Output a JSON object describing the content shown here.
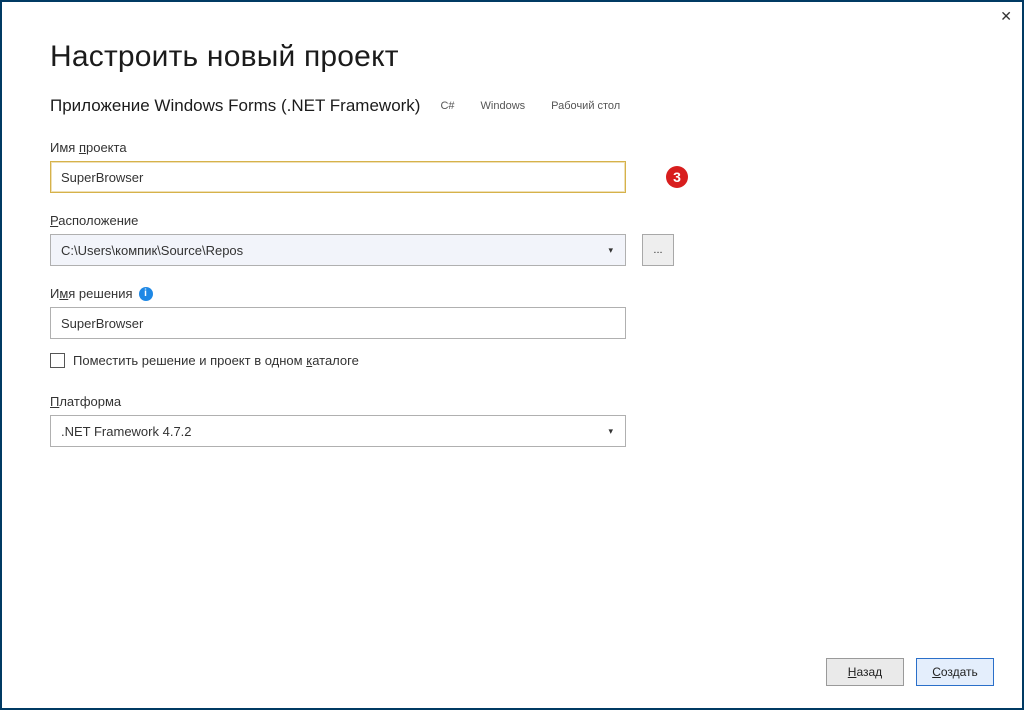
{
  "title": "Настроить новый проект",
  "template": {
    "name": "Приложение Windows Forms (.NET Framework)",
    "tags": [
      "C#",
      "Windows",
      "Рабочий стол"
    ]
  },
  "fields": {
    "projectName": {
      "label_pre": "Имя ",
      "label_key": "п",
      "label_post": "роекта",
      "value": "SuperBrowser"
    },
    "location": {
      "label_key": "Р",
      "label_post": "асположение",
      "value": "C:\\Users\\компик\\Source\\Repos",
      "browse": "..."
    },
    "solutionName": {
      "label_pre": "И",
      "label_key": "м",
      "label_post": "я решения",
      "value": "SuperBrowser"
    },
    "sameDir": {
      "label_pre": "Поместить решение и проект в одном ",
      "label_key": "к",
      "label_post": "аталоге"
    },
    "framework": {
      "label_key": "П",
      "label_post": "латформа",
      "value": ".NET Framework 4.7.2"
    }
  },
  "callout": "3",
  "footer": {
    "back_key": "Н",
    "back_post": "азад",
    "create_key": "С",
    "create_post": "оздать"
  }
}
